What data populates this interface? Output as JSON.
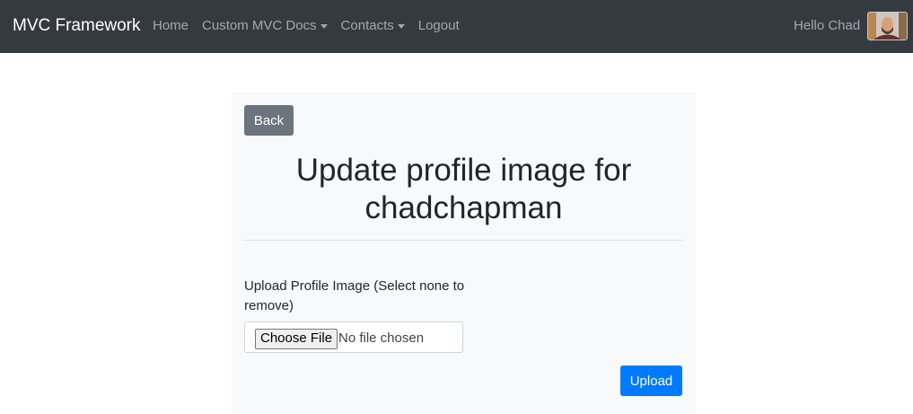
{
  "navbar": {
    "brand": "MVC Framework",
    "links": [
      {
        "label": "Home",
        "dropdown": false
      },
      {
        "label": "Custom MVC Docs",
        "dropdown": true
      },
      {
        "label": "Contacts",
        "dropdown": true
      },
      {
        "label": "Logout",
        "dropdown": false
      }
    ],
    "greeting": "Hello Chad",
    "background": "#343a40"
  },
  "card": {
    "back_label": "Back",
    "title": "Update profile image for chadchapman",
    "upload_label": "Upload Profile Image (Select none to remove)",
    "file_input": {
      "button_label": "Choose File",
      "status": "No file chosen"
    },
    "submit_label": "Upload"
  },
  "colors": {
    "primary": "#007bff",
    "secondary": "#6c757d",
    "card_background": "#f8f9fa"
  },
  "icons": {
    "avatar": "profile-photo",
    "dropdown": "caret-down-icon"
  }
}
